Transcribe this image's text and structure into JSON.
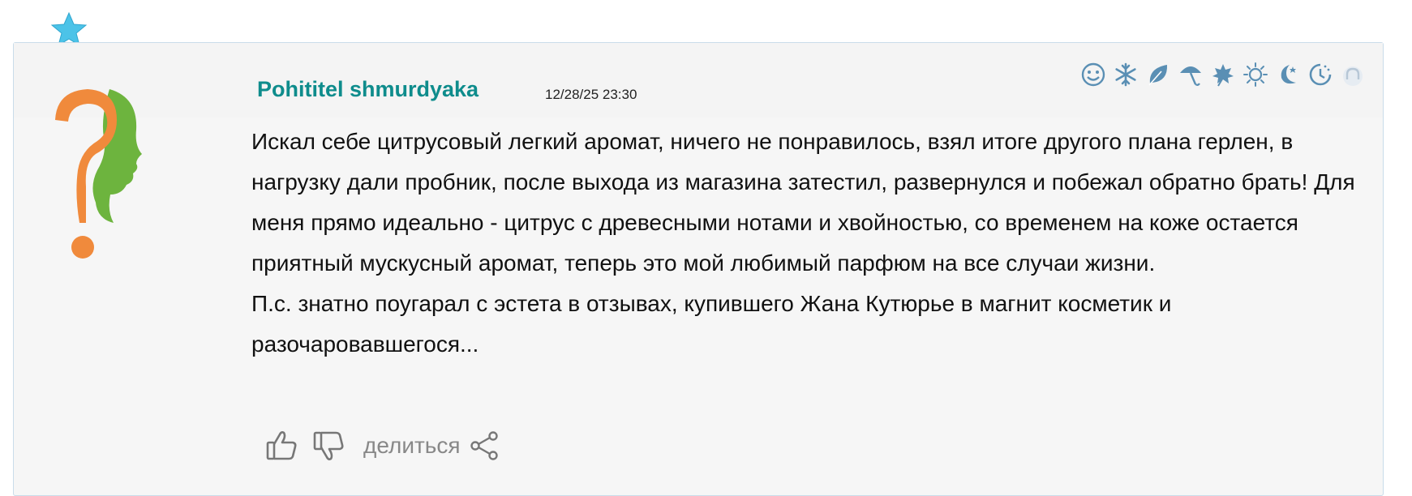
{
  "review": {
    "author": "Pohititel shmurdyaka",
    "timestamp": "12/28/25 23:30",
    "paragraphs": [
      "Искал себе цитрусовый легкий аромат, ничего не понравилось, взял итоге другого плана герлен, в нагрузку дали пробник, после выхода из магазина затестил, развернулся и побежал обратно брать! Для меня прямо идеально - цитрус с древесными нотами и хвойностью, со временем на коже остается приятный мускусный аромат, теперь это мой любимый парфюм на все случаи жизни.",
      "П.с. знатно поугарал с эстета в отзывах, купившего Жана Кутюрье в магнит косметик и разочаровавшегося..."
    ]
  },
  "season_icons": [
    "smile-icon",
    "snowflake-icon",
    "leaf-icon",
    "umbrella-icon",
    "maple-leaf-icon",
    "sun-icon",
    "moon-stars-icon",
    "clock-icon",
    "headphones-icon"
  ],
  "actions": {
    "share_label": "делиться"
  },
  "colors": {
    "author": "#0e8c8c",
    "icon": "#5a8fb4",
    "avatar_orange": "#f08a3c",
    "avatar_green": "#6db43e",
    "star": "#4cc3e8"
  }
}
